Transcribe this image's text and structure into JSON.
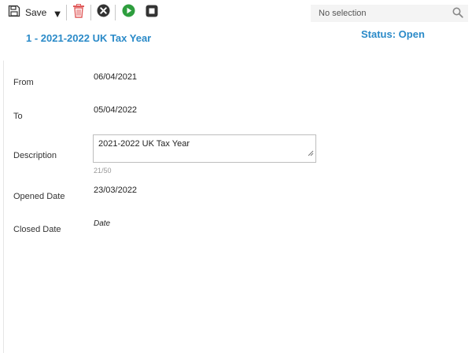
{
  "toolbar": {
    "save_label": "Save",
    "dropdown_glyph": "▼",
    "selection": {
      "text": "No selection"
    }
  },
  "record": {
    "title": "1 - 2021-2022 UK Tax Year",
    "status": "Status: Open"
  },
  "form": {
    "from_label": "From",
    "from_value": "06/04/2021",
    "to_label": "To",
    "to_value": "05/04/2022",
    "description_label": "Description",
    "description_value": "2021-2022 UK Tax Year",
    "description_counter": "21/50",
    "opened_label": "Opened Date",
    "opened_value": "23/03/2022",
    "closed_label": "Closed Date",
    "closed_placeholder": "Date"
  },
  "colors": {
    "accent": "#2a8ac8",
    "delete": "#e05a5a",
    "play": "#2e9e3e",
    "dark_icon": "#333333"
  },
  "icons": [
    "save-icon",
    "dropdown-arrow-icon",
    "trash-icon",
    "cancel-icon",
    "play-icon",
    "stop-icon",
    "search-icon",
    "resize-grip-icon"
  ]
}
